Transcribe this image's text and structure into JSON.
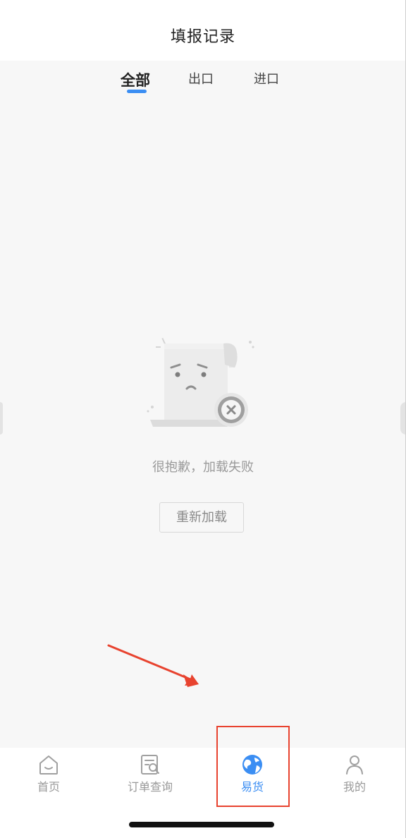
{
  "header": {
    "title": "填报记录"
  },
  "tabs": [
    {
      "label": "全部",
      "active": true
    },
    {
      "label": "出口",
      "active": false
    },
    {
      "label": "进口",
      "active": false
    }
  ],
  "empty_state": {
    "illustration": "sad-document-error-icon",
    "message": "很抱歉，加载失败",
    "reload_label": "重新加载"
  },
  "tabbar": [
    {
      "label": "首页",
      "icon": "home-icon",
      "active": false
    },
    {
      "label": "订单查询",
      "icon": "order-search-icon",
      "active": false
    },
    {
      "label": "易货",
      "icon": "globe-icon",
      "active": true
    },
    {
      "label": "我的",
      "icon": "user-icon",
      "active": false
    }
  ],
  "colors": {
    "accent": "#3b8ef3",
    "annotation": "#e8432f",
    "background": "#f7f7f7",
    "muted_text": "#999999"
  }
}
